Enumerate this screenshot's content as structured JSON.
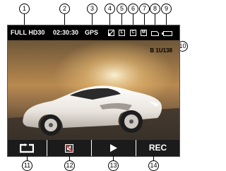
{
  "callouts": [
    "1",
    "2",
    "3",
    "4",
    "5",
    "6",
    "7",
    "8",
    "9",
    "10",
    "11",
    "12",
    "13",
    "14"
  ],
  "status": {
    "resolution": "FULL HD30",
    "timer": "02:30:30",
    "gps": "GPS",
    "icon_l": "L",
    "icon_c": "C",
    "icon_m": "M"
  },
  "overlay": {
    "plate": "B 1U138"
  },
  "controls": {
    "record_label": "REC",
    "play_icon": "play-icon",
    "loop_icon": "loop-icon",
    "mute_icon": "mute-icon"
  },
  "colors": {
    "status_bg": "#000000",
    "text": "#ffffff"
  }
}
